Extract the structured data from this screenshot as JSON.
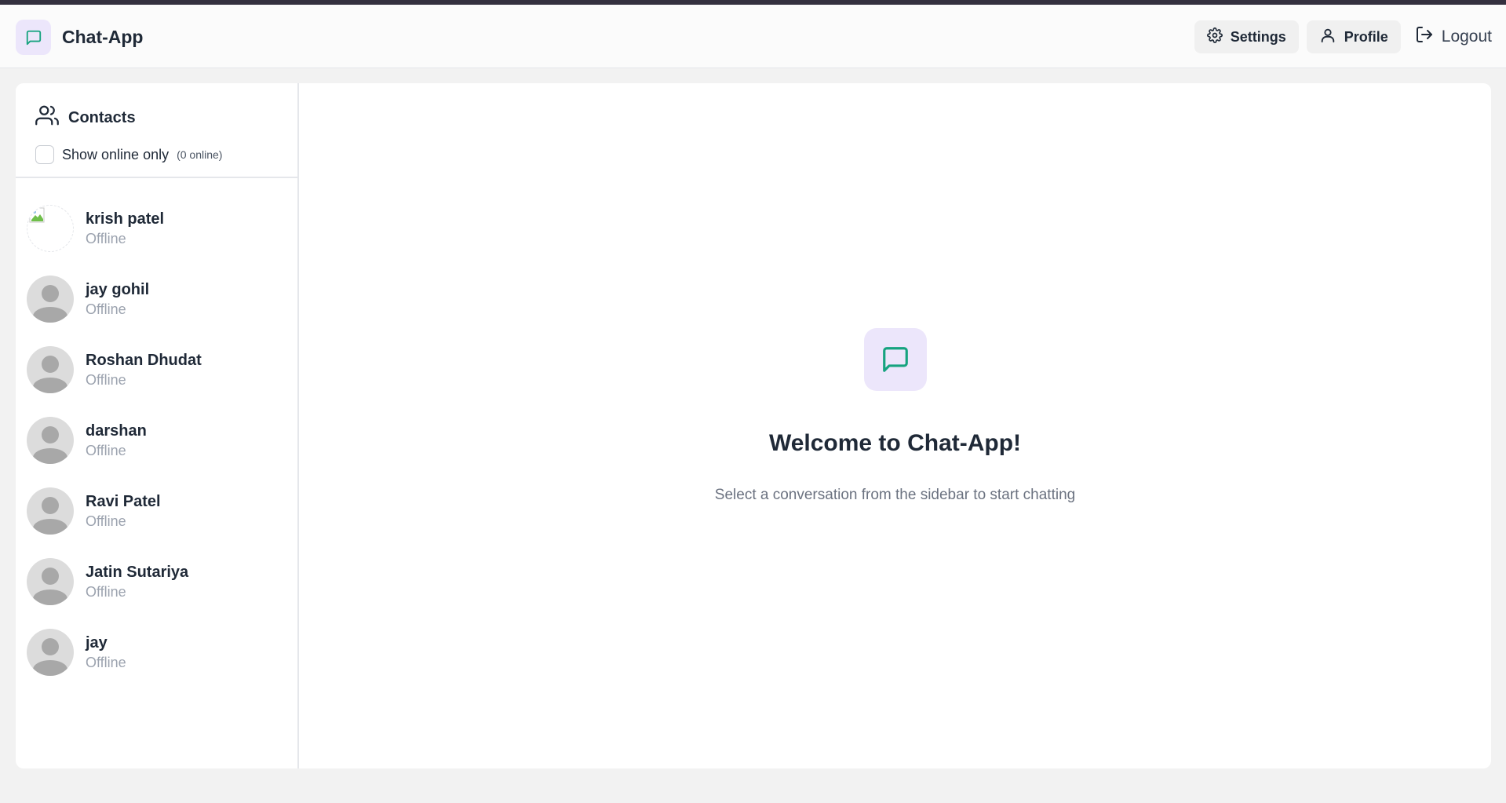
{
  "app": {
    "title": "Chat-App",
    "brand_icon": "message-square-icon",
    "accent_color": "#16a37f",
    "icon_bg_color": "#ece6fb"
  },
  "nav": {
    "settings_label": "Settings",
    "profile_label": "Profile",
    "logout_label": "Logout"
  },
  "sidebar": {
    "title": "Contacts",
    "show_online_label": "Show online only",
    "online_count": "(0 online)",
    "show_online_checked": false,
    "contacts": [
      {
        "name": "krish patel",
        "status": "Offline",
        "avatar": "broken-image"
      },
      {
        "name": "jay gohil",
        "status": "Offline",
        "avatar": "default-avatar"
      },
      {
        "name": "Roshan Dhudat",
        "status": "Offline",
        "avatar": "default-avatar"
      },
      {
        "name": "darshan",
        "status": "Offline",
        "avatar": "default-avatar"
      },
      {
        "name": "Ravi Patel",
        "status": "Offline",
        "avatar": "default-avatar"
      },
      {
        "name": "Jatin Sutariya",
        "status": "Offline",
        "avatar": "default-avatar"
      },
      {
        "name": "jay",
        "status": "Offline",
        "avatar": "default-avatar"
      }
    ]
  },
  "main": {
    "welcome_title": "Welcome to Chat-App!",
    "welcome_subtitle": "Select a conversation from the sidebar to start chatting"
  }
}
